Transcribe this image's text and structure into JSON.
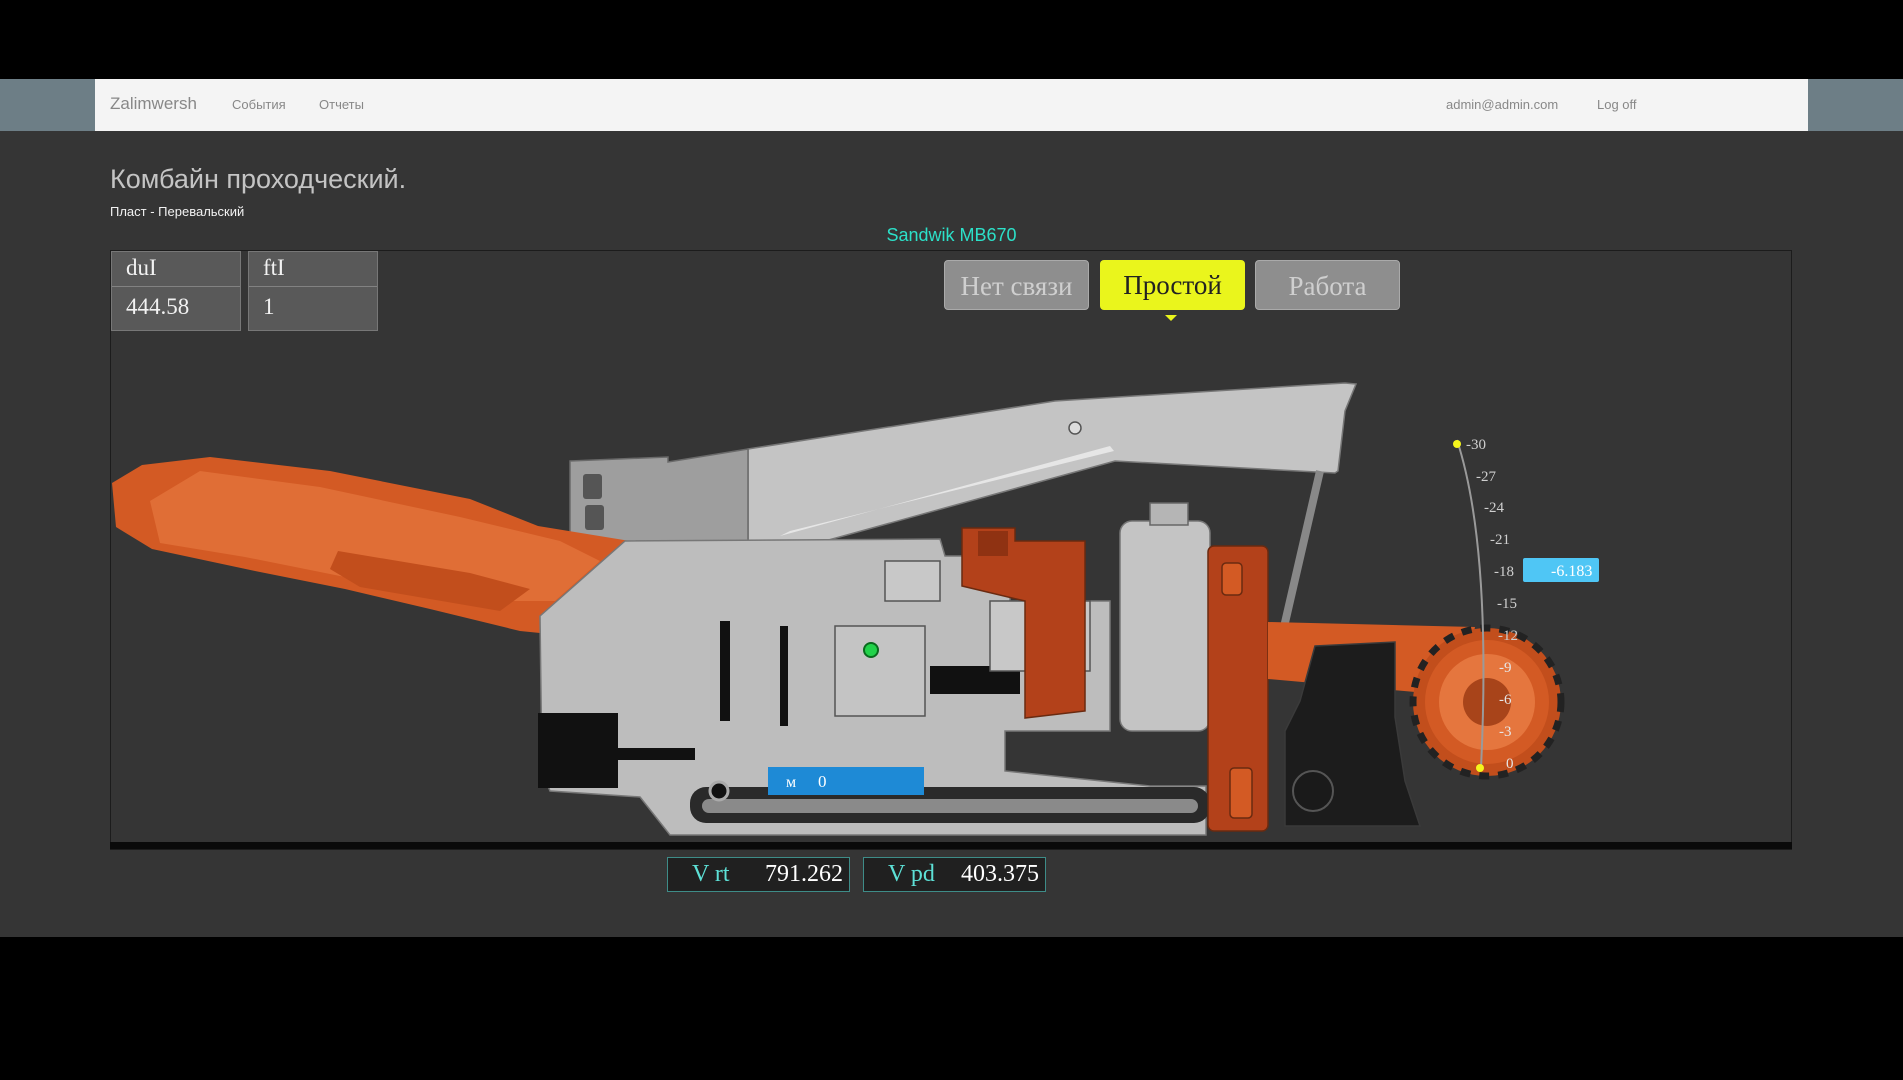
{
  "nav": {
    "brand": "Zalimwersh",
    "links": [
      "События",
      "Отчеты"
    ],
    "user": "admin@admin.com",
    "logoff": "Log off"
  },
  "page": {
    "title": "Комбайн проходческий.",
    "subtitle": "Пласт - Перевальский",
    "machine_name": "Sandwik MB670"
  },
  "readouts": [
    {
      "label": "duI",
      "value": "444.58"
    },
    {
      "label": "ftI",
      "value": "1"
    }
  ],
  "states": {
    "no_link": "Нет связи",
    "idle": "Простой",
    "work": "Работа",
    "active": "idle",
    "active_color": "#eaf51c"
  },
  "position_bar": {
    "label": "м",
    "value": "0"
  },
  "angle_gauge": {
    "ticks": [
      "-30",
      "-27",
      "-24",
      "-21",
      "-18",
      "-15",
      "-12",
      "-9",
      "-6",
      "-3",
      "0"
    ],
    "value": "-6.183"
  },
  "speeds": [
    {
      "label": "V rt",
      "value": "791.262"
    },
    {
      "label": "V pd",
      "value": "403.375"
    }
  ],
  "colors": {
    "accent": "#2ce0c8",
    "indicator_blue": "#1e8ad6",
    "gauge_blue": "#4fc6f5",
    "machine_orange": "#d35a24"
  }
}
